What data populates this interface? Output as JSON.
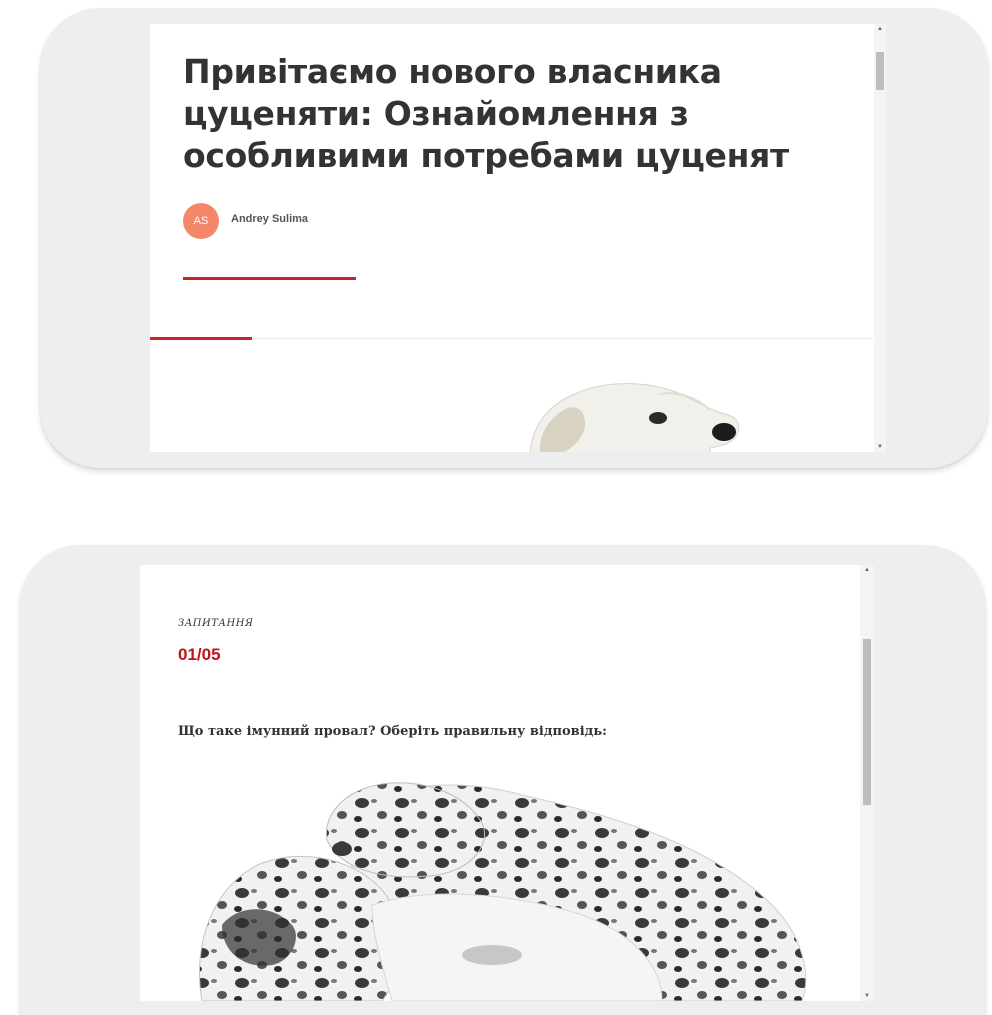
{
  "article_card": {
    "title": "Привітаємо нового власника цуценяти: Ознайомлення з особливими потребами цуценят",
    "author_initials": "AS",
    "author_name": "Andrey Sulima"
  },
  "quiz_card": {
    "label": "ЗАПИТАННЯ",
    "counter": "01/05",
    "question": "Що таке імунний провал? Оберіть правильну відповідь:"
  },
  "colors": {
    "accent_red": "#c3111b",
    "avatar": "#f4876a",
    "frame": "#eeeeee"
  },
  "icons": {
    "scroll_up": "triangle-up",
    "scroll_down": "triangle-down"
  }
}
